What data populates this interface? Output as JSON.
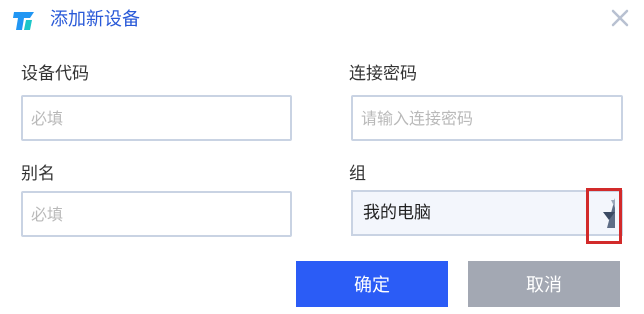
{
  "dialog": {
    "title": "添加新设备"
  },
  "form": {
    "device_code": {
      "label": "设备代码",
      "placeholder": "必填",
      "value": ""
    },
    "connect_password": {
      "label": "连接密码",
      "placeholder": "请输入连接密码",
      "value": ""
    },
    "alias": {
      "label": "别名",
      "placeholder": "必填",
      "value": ""
    },
    "group": {
      "label": "组",
      "selected": "我的电脑"
    }
  },
  "buttons": {
    "ok": "确定",
    "cancel": "取消"
  },
  "icons": {
    "logo": "app-logo-icon",
    "close": "close-icon",
    "dropdown": "dropdown-arrow-icon"
  },
  "colors": {
    "accent": "#2b5cf6",
    "title": "#2a5ad8",
    "cancel": "#a3a8b3",
    "highlight": "#d22a2a"
  }
}
